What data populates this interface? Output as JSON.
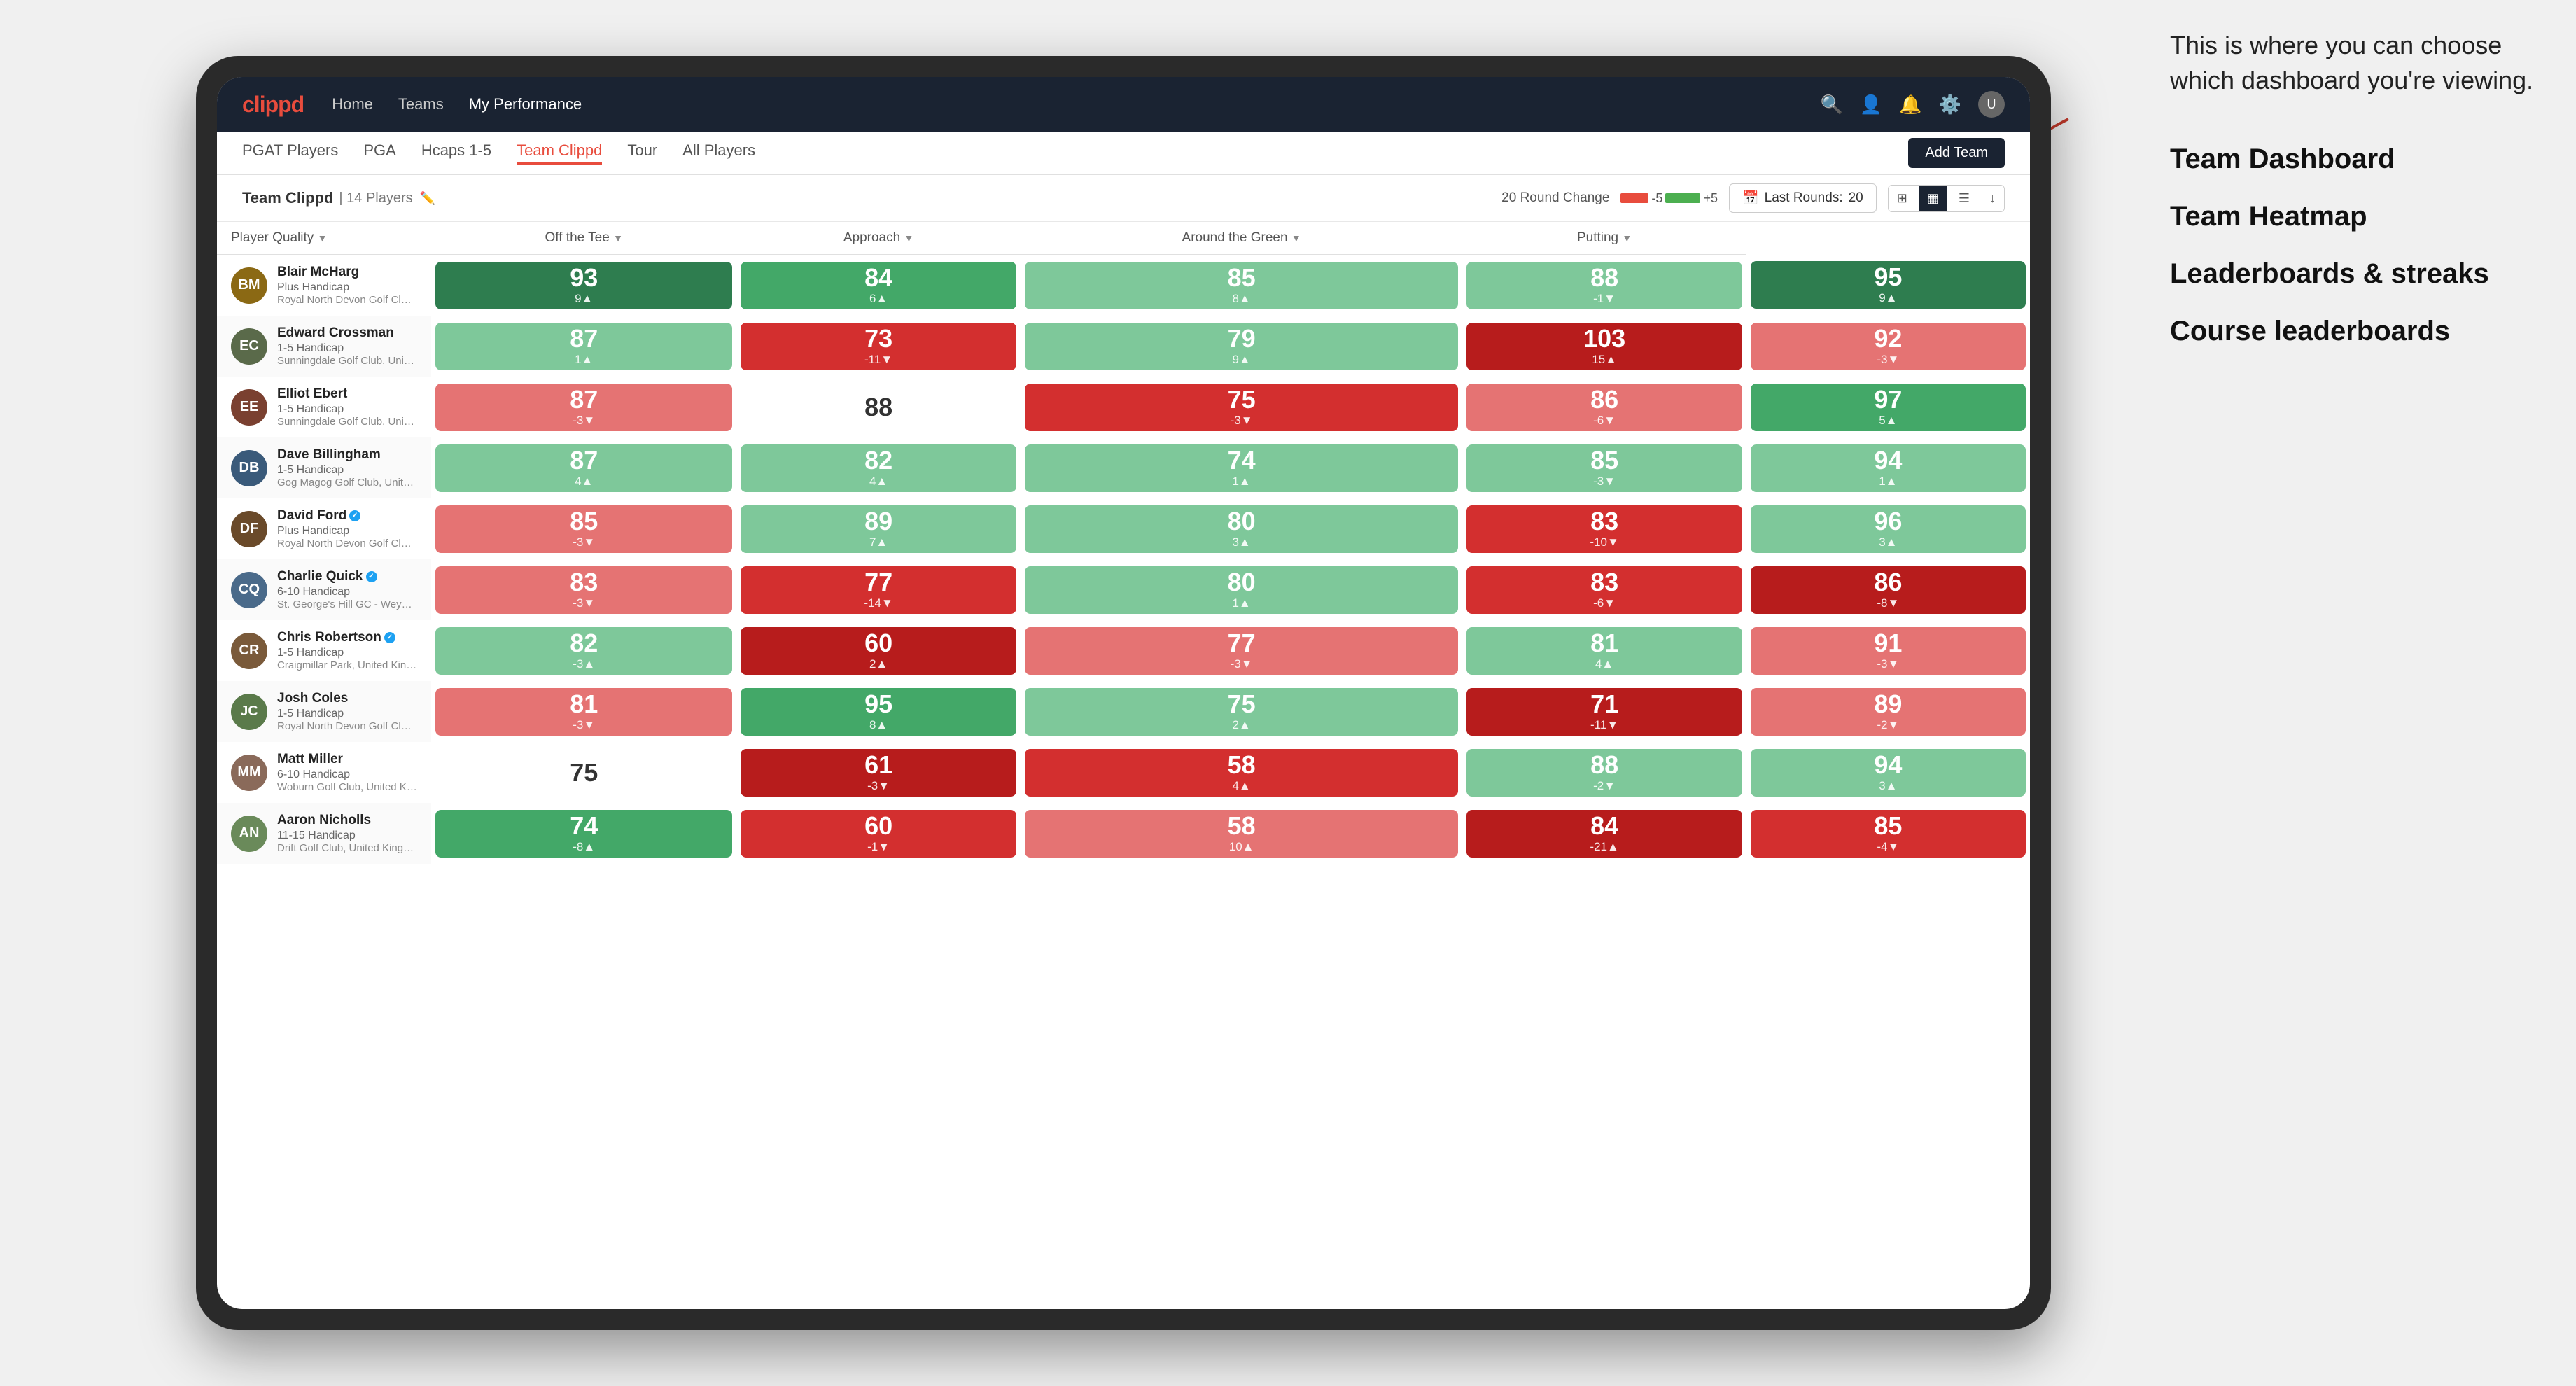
{
  "annotation": {
    "intro_text": "This is where you can choose which dashboard you're viewing.",
    "options": [
      {
        "label": "Team Dashboard"
      },
      {
        "label": "Team Heatmap"
      },
      {
        "label": "Leaderboards & streaks"
      },
      {
        "label": "Course leaderboards"
      }
    ]
  },
  "nav": {
    "logo": "clippd",
    "links": [
      "Home",
      "Teams",
      "My Performance"
    ],
    "active_link": "My Performance"
  },
  "sub_nav": {
    "links": [
      "PGAT Players",
      "PGA",
      "Hcaps 1-5",
      "Team Clippd",
      "Tour",
      "All Players"
    ],
    "active_link": "Team Clippd",
    "add_team_label": "Add Team"
  },
  "team_header": {
    "name": "Team Clippd",
    "separator": "|",
    "count": "14 Players",
    "round_change_label": "20 Round Change",
    "neg_label": "-5",
    "pos_label": "+5",
    "last_rounds_label": "Last Rounds:",
    "last_rounds_value": "20"
  },
  "table": {
    "col_headers": [
      {
        "label": "Player Quality",
        "sortable": true
      },
      {
        "label": "Off the Tee",
        "sortable": true
      },
      {
        "label": "Approach",
        "sortable": true
      },
      {
        "label": "Around the Green",
        "sortable": true
      },
      {
        "label": "Putting",
        "sortable": true
      }
    ],
    "players": [
      {
        "name": "Blair McHarg",
        "handicap": "Plus Handicap",
        "club": "Royal North Devon Golf Club, United Kingdom",
        "avatar_color": "#8B6914",
        "initials": "BM",
        "scores": [
          {
            "value": "93",
            "change": "9▲",
            "color_class": "c-g1"
          },
          {
            "value": "84",
            "change": "6▲",
            "color_class": "c-g2"
          },
          {
            "value": "85",
            "change": "8▲",
            "color_class": "c-g3"
          },
          {
            "value": "88",
            "change": "-1▼",
            "color_class": "c-g3"
          },
          {
            "value": "95",
            "change": "9▲",
            "color_class": "c-g1"
          }
        ]
      },
      {
        "name": "Edward Crossman",
        "handicap": "1-5 Handicap",
        "club": "Sunningdale Golf Club, United Kingdom",
        "avatar_color": "#5a6a4a",
        "initials": "EC",
        "scores": [
          {
            "value": "87",
            "change": "1▲",
            "color_class": "c-g3"
          },
          {
            "value": "73",
            "change": "-11▼",
            "color_class": "c-r2"
          },
          {
            "value": "79",
            "change": "9▲",
            "color_class": "c-g3"
          },
          {
            "value": "103",
            "change": "15▲",
            "color_class": "c-r1"
          },
          {
            "value": "92",
            "change": "-3▼",
            "color_class": "c-r3"
          }
        ]
      },
      {
        "name": "Elliot Ebert",
        "handicap": "1-5 Handicap",
        "club": "Sunningdale Golf Club, United Kingdom",
        "avatar_color": "#7a4030",
        "initials": "EE",
        "scores": [
          {
            "value": "87",
            "change": "-3▼",
            "color_class": "c-r3"
          },
          {
            "value": "88",
            "change": "",
            "color_class": "c-w"
          },
          {
            "value": "75",
            "change": "-3▼",
            "color_class": "c-r2"
          },
          {
            "value": "86",
            "change": "-6▼",
            "color_class": "c-r3"
          },
          {
            "value": "97",
            "change": "5▲",
            "color_class": "c-g2"
          }
        ]
      },
      {
        "name": "Dave Billingham",
        "handicap": "1-5 Handicap",
        "club": "Gog Magog Golf Club, United Kingdom",
        "avatar_color": "#3a5a7a",
        "initials": "DB",
        "scores": [
          {
            "value": "87",
            "change": "4▲",
            "color_class": "c-g3"
          },
          {
            "value": "82",
            "change": "4▲",
            "color_class": "c-g3"
          },
          {
            "value": "74",
            "change": "1▲",
            "color_class": "c-g3"
          },
          {
            "value": "85",
            "change": "-3▼",
            "color_class": "c-g3"
          },
          {
            "value": "94",
            "change": "1▲",
            "color_class": "c-g3"
          }
        ]
      },
      {
        "name": "David Ford",
        "handicap": "Plus Handicap",
        "club": "Royal North Devon Golf Club, United Kingdom",
        "avatar_color": "#6a4a2a",
        "initials": "DF",
        "verified": true,
        "scores": [
          {
            "value": "85",
            "change": "-3▼",
            "color_class": "c-r3"
          },
          {
            "value": "89",
            "change": "7▲",
            "color_class": "c-g3"
          },
          {
            "value": "80",
            "change": "3▲",
            "color_class": "c-g3"
          },
          {
            "value": "83",
            "change": "-10▼",
            "color_class": "c-r2"
          },
          {
            "value": "96",
            "change": "3▲",
            "color_class": "c-g3"
          }
        ]
      },
      {
        "name": "Charlie Quick",
        "handicap": "6-10 Handicap",
        "club": "St. George's Hill GC - Weybridge, Surrey, Uni...",
        "avatar_color": "#4a6a8a",
        "initials": "CQ",
        "verified": true,
        "scores": [
          {
            "value": "83",
            "change": "-3▼",
            "color_class": "c-r3"
          },
          {
            "value": "77",
            "change": "-14▼",
            "color_class": "c-r2"
          },
          {
            "value": "80",
            "change": "1▲",
            "color_class": "c-g3"
          },
          {
            "value": "83",
            "change": "-6▼",
            "color_class": "c-r2"
          },
          {
            "value": "86",
            "change": "-8▼",
            "color_class": "c-r1"
          }
        ]
      },
      {
        "name": "Chris Robertson",
        "handicap": "1-5 Handicap",
        "club": "Craigmillar Park, United Kingdom",
        "avatar_color": "#7a5a3a",
        "initials": "CR",
        "verified": true,
        "scores": [
          {
            "value": "82",
            "change": "-3▲",
            "color_class": "c-g3"
          },
          {
            "value": "60",
            "change": "2▲",
            "color_class": "c-r1"
          },
          {
            "value": "77",
            "change": "-3▼",
            "color_class": "c-r3"
          },
          {
            "value": "81",
            "change": "4▲",
            "color_class": "c-g3"
          },
          {
            "value": "91",
            "change": "-3▼",
            "color_class": "c-r3"
          }
        ]
      },
      {
        "name": "Josh Coles",
        "handicap": "1-5 Handicap",
        "club": "Royal North Devon Golf Club, United Kingdom",
        "avatar_color": "#5a7a4a",
        "initials": "JC",
        "scores": [
          {
            "value": "81",
            "change": "-3▼",
            "color_class": "c-r3"
          },
          {
            "value": "95",
            "change": "8▲",
            "color_class": "c-g2"
          },
          {
            "value": "75",
            "change": "2▲",
            "color_class": "c-g3"
          },
          {
            "value": "71",
            "change": "-11▼",
            "color_class": "c-r1"
          },
          {
            "value": "89",
            "change": "-2▼",
            "color_class": "c-r3"
          }
        ]
      },
      {
        "name": "Matt Miller",
        "handicap": "6-10 Handicap",
        "club": "Woburn Golf Club, United Kingdom",
        "avatar_color": "#8a6a5a",
        "initials": "MM",
        "scores": [
          {
            "value": "75",
            "change": "",
            "color_class": "c-w"
          },
          {
            "value": "61",
            "change": "-3▼",
            "color_class": "c-r1"
          },
          {
            "value": "58",
            "change": "4▲",
            "color_class": "c-r2"
          },
          {
            "value": "88",
            "change": "-2▼",
            "color_class": "c-g3"
          },
          {
            "value": "94",
            "change": "3▲",
            "color_class": "c-g3"
          }
        ]
      },
      {
        "name": "Aaron Nicholls",
        "handicap": "11-15 Handicap",
        "club": "Drift Golf Club, United Kingdom",
        "avatar_color": "#6a8a5a",
        "initials": "AN",
        "scores": [
          {
            "value": "74",
            "change": "-8▲",
            "color_class": "c-g2"
          },
          {
            "value": "60",
            "change": "-1▼",
            "color_class": "c-r2"
          },
          {
            "value": "58",
            "change": "10▲",
            "color_class": "c-r3"
          },
          {
            "value": "84",
            "change": "-21▲",
            "color_class": "c-r1"
          },
          {
            "value": "85",
            "change": "-4▼",
            "color_class": "c-r2"
          }
        ]
      }
    ]
  }
}
